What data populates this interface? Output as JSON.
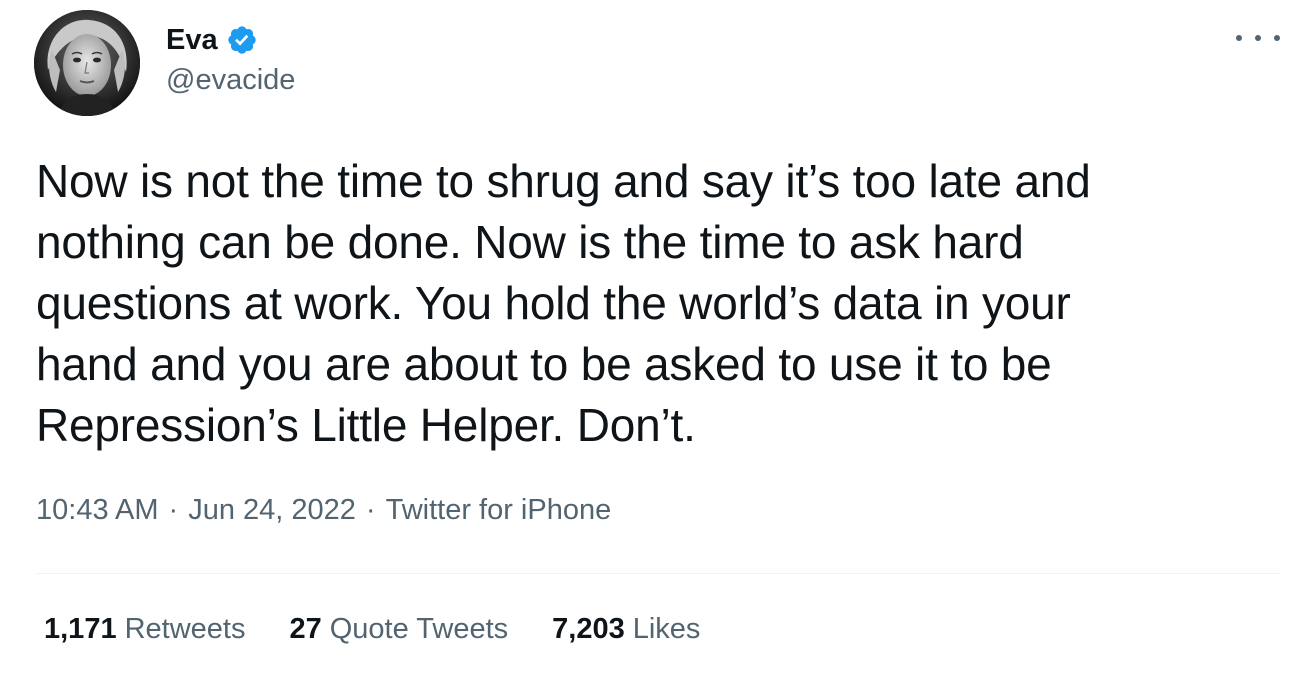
{
  "author": {
    "display_name": "Eva",
    "handle": "@evacide",
    "verified": true,
    "avatar_icon": "user-avatar-photo"
  },
  "tweet": {
    "text": "Now is not the time to shrug and say it’s too late and\nnothing can be done. Now is the time to ask hard\nquestions at work. You hold the world’s data in your\nhand and you are about to be asked to use it to be\nRepression’s Little Helper. Don’t."
  },
  "meta": {
    "time": "10:43 AM",
    "separator": "·",
    "date": "Jun 24, 2022",
    "source": "Twitter for iPhone"
  },
  "stats": {
    "retweets": {
      "count": "1,171",
      "label": "Retweets"
    },
    "quote_tweets": {
      "count": "27",
      "label": "Quote Tweets"
    },
    "likes": {
      "count": "7,203",
      "label": "Likes"
    }
  },
  "colors": {
    "text_primary": "#0f1419",
    "text_secondary": "#536471",
    "verified_blue": "#1d9bf0",
    "divider": "#eff3f4"
  },
  "icons": {
    "more": "more-options-icon",
    "verified": "verified-badge-icon"
  }
}
